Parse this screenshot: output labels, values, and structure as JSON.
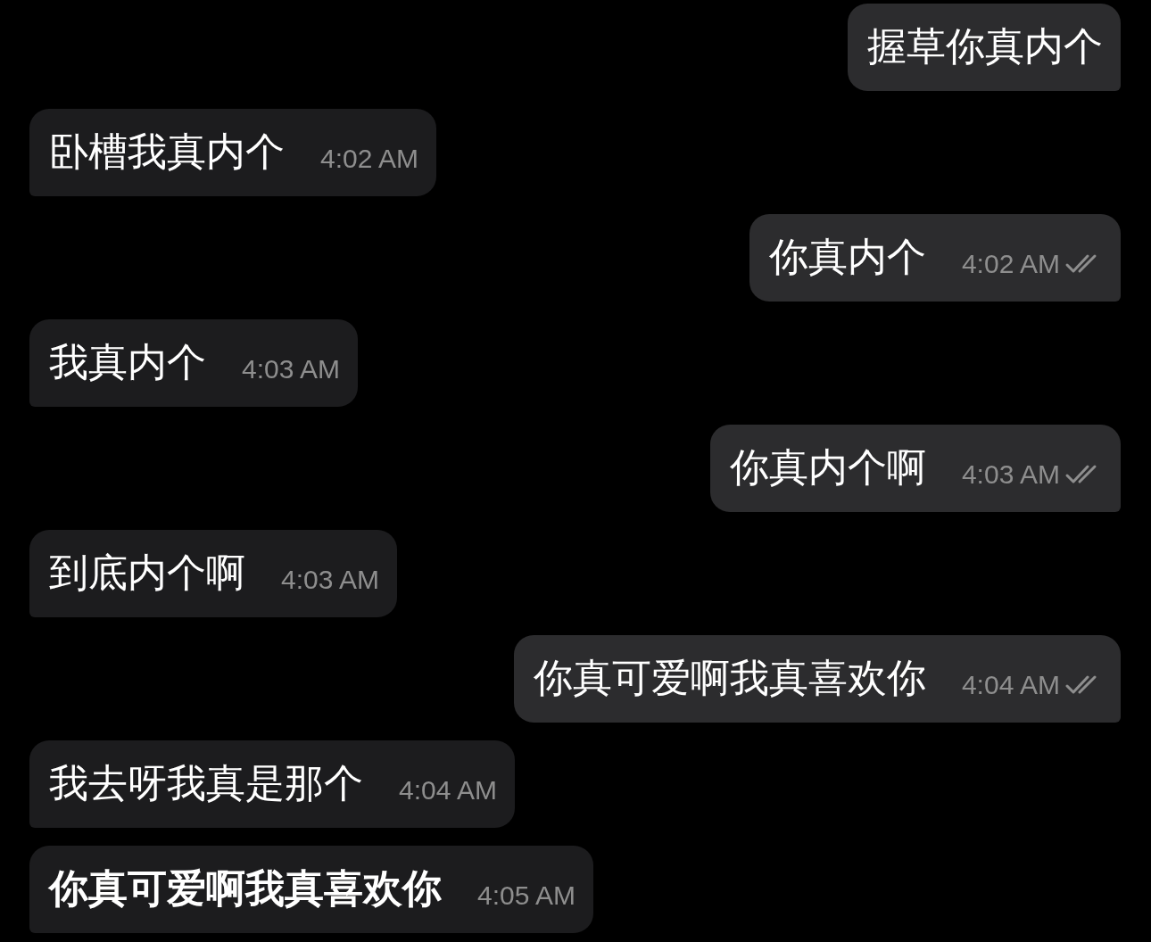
{
  "messages": [
    {
      "kind": "outgoing",
      "text": "握草你真内个",
      "read": false,
      "bold": false
    },
    {
      "kind": "incoming",
      "text": "卧槽我真内个",
      "time": "4:02 AM",
      "bold": false
    },
    {
      "kind": "outgoing",
      "text": "你真内个",
      "time": "4:02 AM",
      "read": true,
      "bold": false
    },
    {
      "kind": "incoming",
      "text": "我真内个",
      "time": "4:03 AM",
      "bold": false
    },
    {
      "kind": "outgoing",
      "text": "你真内个啊",
      "time": "4:03 AM",
      "read": true,
      "bold": false
    },
    {
      "kind": "incoming",
      "text": "到底内个啊",
      "time": "4:03 AM",
      "bold": false
    },
    {
      "kind": "outgoing",
      "text": "你真可爱啊我真喜欢你",
      "time": "4:04 AM",
      "read": true,
      "bold": false
    },
    {
      "kind": "incoming",
      "text": "我去呀我真是那个",
      "time": "4:04 AM",
      "bold": false
    },
    {
      "kind": "incoming",
      "text": "你真可爱啊我真喜欢你",
      "time": "4:05 AM",
      "bold": true
    }
  ]
}
